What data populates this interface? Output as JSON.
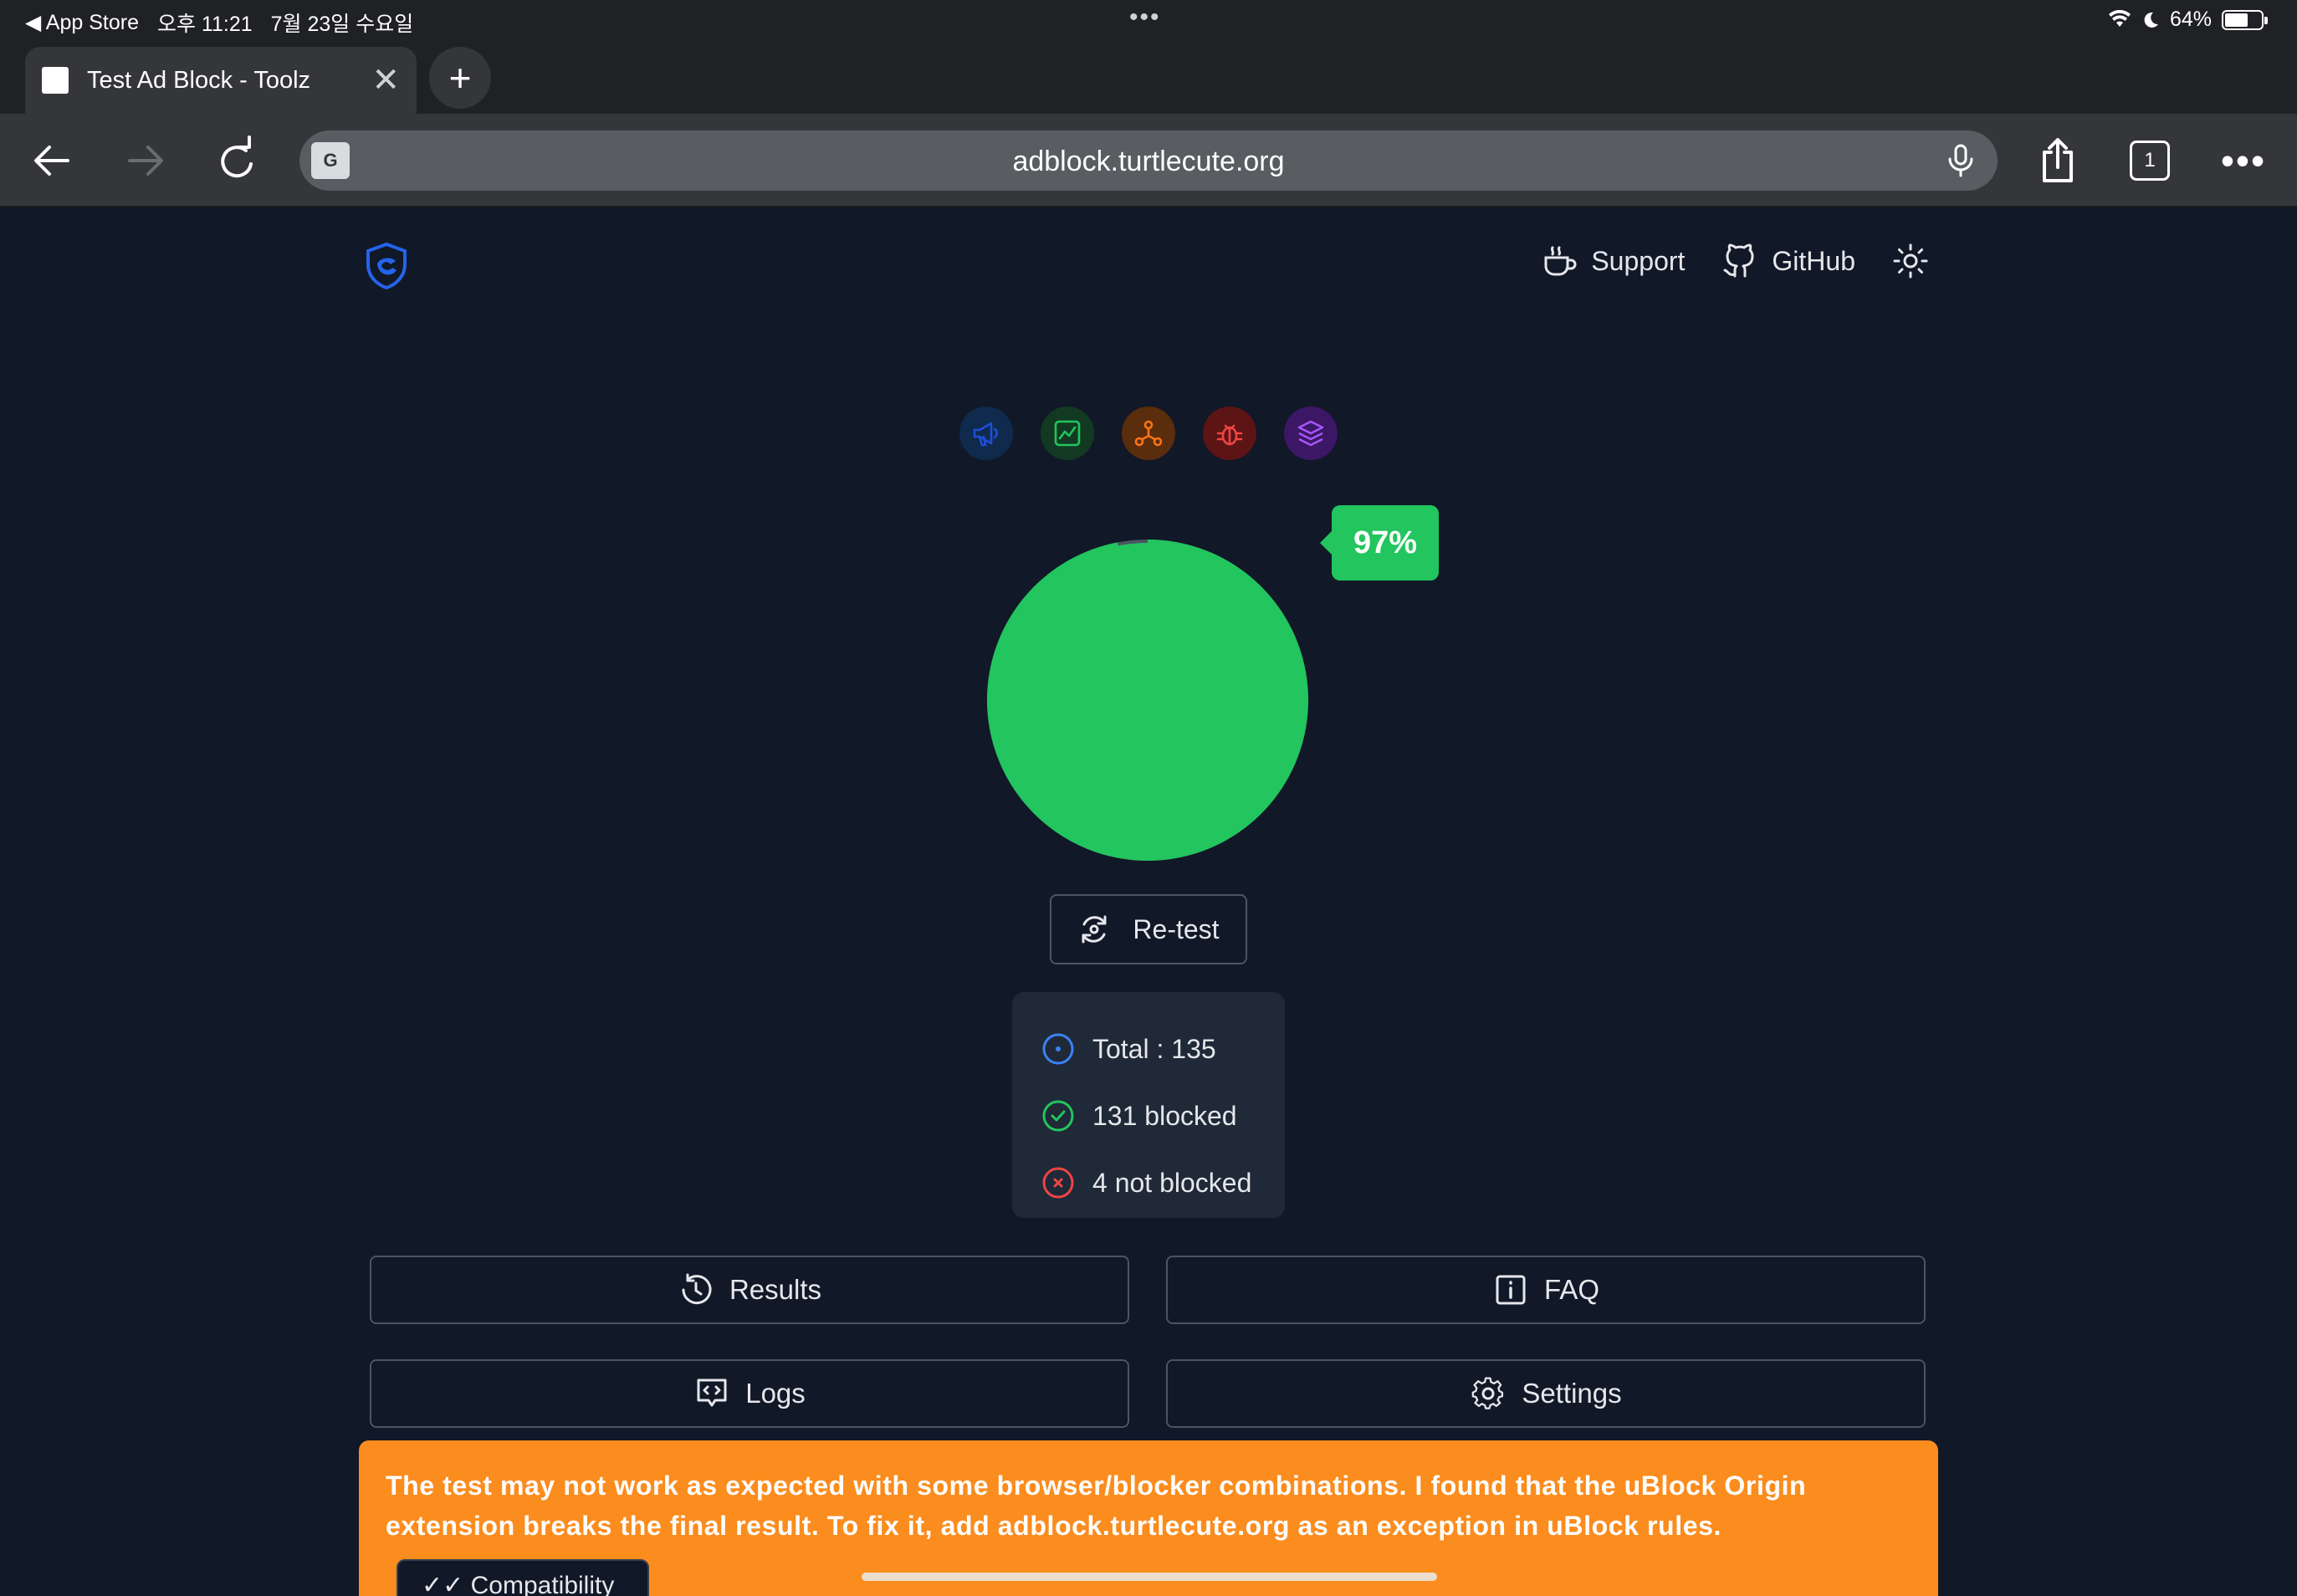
{
  "status_bar": {
    "back_app": "◀ App Store",
    "time": "오후 11:21",
    "date": "7월 23일 수요일",
    "multitask_dots": "•••",
    "battery_label": "64%",
    "battery_level": 0.64
  },
  "browser": {
    "tab_title": "Test Ad Block - Toolz",
    "new_tab_label": "+",
    "url": "adblock.turtlecute.org",
    "tab_count": "1",
    "translate_label": "G"
  },
  "site": {
    "nav": {
      "support": "Support",
      "github": "GitHub"
    },
    "categories": [
      {
        "name": "ads-icon",
        "color": "#1d4ed8",
        "bg": "#0f2a4d"
      },
      {
        "name": "analytics-icon",
        "color": "#22c55e",
        "bg": "#123a22"
      },
      {
        "name": "trackers-icon",
        "color": "#f97316",
        "bg": "#5a2d0c"
      },
      {
        "name": "error-monitors-icon",
        "color": "#ef4444",
        "bg": "#5c1414"
      },
      {
        "name": "mix-icon",
        "color": "#a855f7",
        "bg": "#3b1766"
      }
    ],
    "score": {
      "percent_label": "97%",
      "blocked_fraction": 0.97,
      "fill_color": "#22c55e",
      "ring_color": "#4b5563"
    },
    "retest_label": "Re-test",
    "stats": {
      "total": "Total : 135",
      "blocked": "131 blocked",
      "not_blocked": "4 not blocked"
    },
    "buttons": {
      "results": "Results",
      "faq": "FAQ",
      "logs": "Logs",
      "settings": "Settings"
    },
    "warning_line1": "The test may not work as expected with some browser/blocker combinations. I found that the uBlock Origin",
    "warning_line2": "extension breaks the final result. To fix it, add adblock.turtlecute.org as an exception in uBlock rules.",
    "compat_label": "✓✓ Compatibility"
  }
}
